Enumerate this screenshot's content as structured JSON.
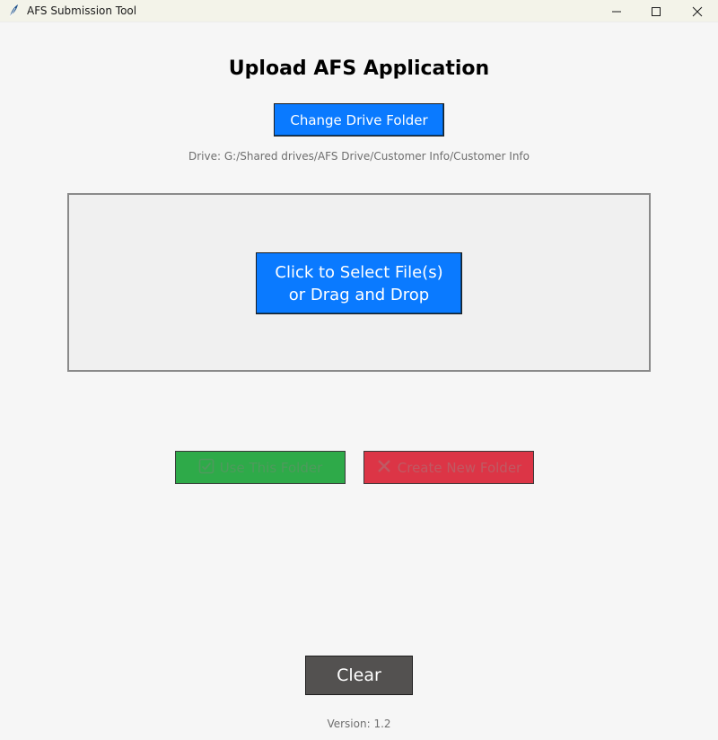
{
  "window": {
    "title": "AFS Submission Tool",
    "controls": [
      "minimize-icon",
      "maximize-icon",
      "close-icon"
    ]
  },
  "main": {
    "heading": "Upload AFS Application",
    "change_drive_label": "Change Drive Folder",
    "drive_path": "Drive: G:/Shared drives/AFS Drive/Customer Info/Customer Info",
    "drop_zone": {
      "select_line1": "Click to Select File(s)",
      "select_line2": "or Drag and Drop"
    },
    "use_folder": {
      "label": "Use This Folder",
      "icon": "checkbox-icon",
      "enabled": false
    },
    "create_folder": {
      "label": "Create New Folder",
      "icon": "x-icon",
      "enabled": false
    },
    "clear_label": "Clear",
    "version": "Version: 1.2"
  },
  "colors": {
    "primary_blue": "#0a7aff",
    "success_green": "#2eaa49",
    "danger_red": "#dc3546",
    "clear_gray": "#535150",
    "background": "#f6f6f6"
  }
}
